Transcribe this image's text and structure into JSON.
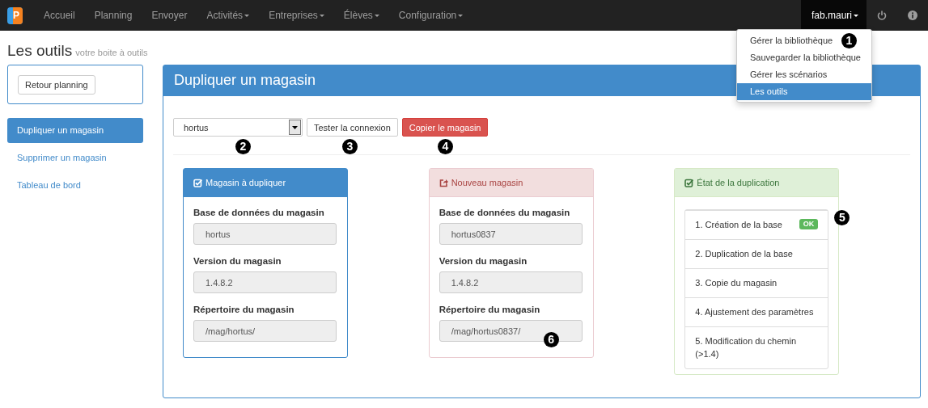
{
  "navbar": {
    "logo": "P",
    "items": [
      {
        "label": "Accueil",
        "caret": false
      },
      {
        "label": "Planning",
        "caret": false
      },
      {
        "label": "Envoyer",
        "caret": false
      },
      {
        "label": "Activités",
        "caret": true
      },
      {
        "label": "Entreprises",
        "caret": true
      },
      {
        "label": "Élèves",
        "caret": true
      },
      {
        "label": "Configuration",
        "caret": true
      }
    ],
    "user": {
      "label": "fab.mauri",
      "expanded": true,
      "menu": [
        {
          "label": "Gérer la bibliothèque",
          "selected": false,
          "callout": "1"
        },
        {
          "label": "Sauvegarder la bibliothèque",
          "selected": false
        },
        {
          "label": "Gérer les scénarios",
          "selected": false
        },
        {
          "label": "Les outils",
          "selected": true
        }
      ]
    }
  },
  "page_header": {
    "title": "Les outils",
    "subtitle": "votre boite à outils"
  },
  "sidebar": {
    "back_button": "Retour planning",
    "items": [
      {
        "label": "Dupliquer un magasin",
        "selected": true
      },
      {
        "label": "Supprimer un magasin",
        "selected": false
      },
      {
        "label": "Tableau de bord",
        "selected": false
      }
    ]
  },
  "main_panel": {
    "title": "Dupliquer un magasin",
    "toolbar": {
      "select": {
        "value": "hortus",
        "callout": "2"
      },
      "buttons": [
        {
          "label": "Tester la connexion",
          "kind": "default",
          "callout": "3"
        },
        {
          "label": "Copier le magasin",
          "kind": "danger",
          "callout": "4"
        }
      ]
    },
    "cards": [
      {
        "kind": "primary",
        "title": "Magasin à dupliquer",
        "fields": [
          {
            "label": "Base de données du magasin",
            "value": "hortus"
          },
          {
            "label": "Version du magasin",
            "value": "1.4.8.2"
          },
          {
            "label": "Répertoire du magasin",
            "value": "/mag/hortus/"
          }
        ]
      },
      {
        "kind": "danger",
        "title": "Nouveau magasin",
        "fields": [
          {
            "label": "Base de données du magasin",
            "value": "hortus0837"
          },
          {
            "label": "Version du magasin",
            "value": "1.4.8.2"
          },
          {
            "label": "Répertoire du magasin",
            "value": "/mag/hortus0837/",
            "callout": "6"
          }
        ]
      },
      {
        "kind": "success",
        "title": "État de la duplication",
        "callout": "5",
        "steps": [
          {
            "label": "1. Création de la base",
            "badge": "OK"
          },
          {
            "label": "2. Duplication de la base"
          },
          {
            "label": "3. Copie du magasin"
          },
          {
            "label": "4. Ajustement des paramètres"
          },
          {
            "label": "5. Modification du chemin (>1.4)"
          }
        ]
      }
    ]
  }
}
